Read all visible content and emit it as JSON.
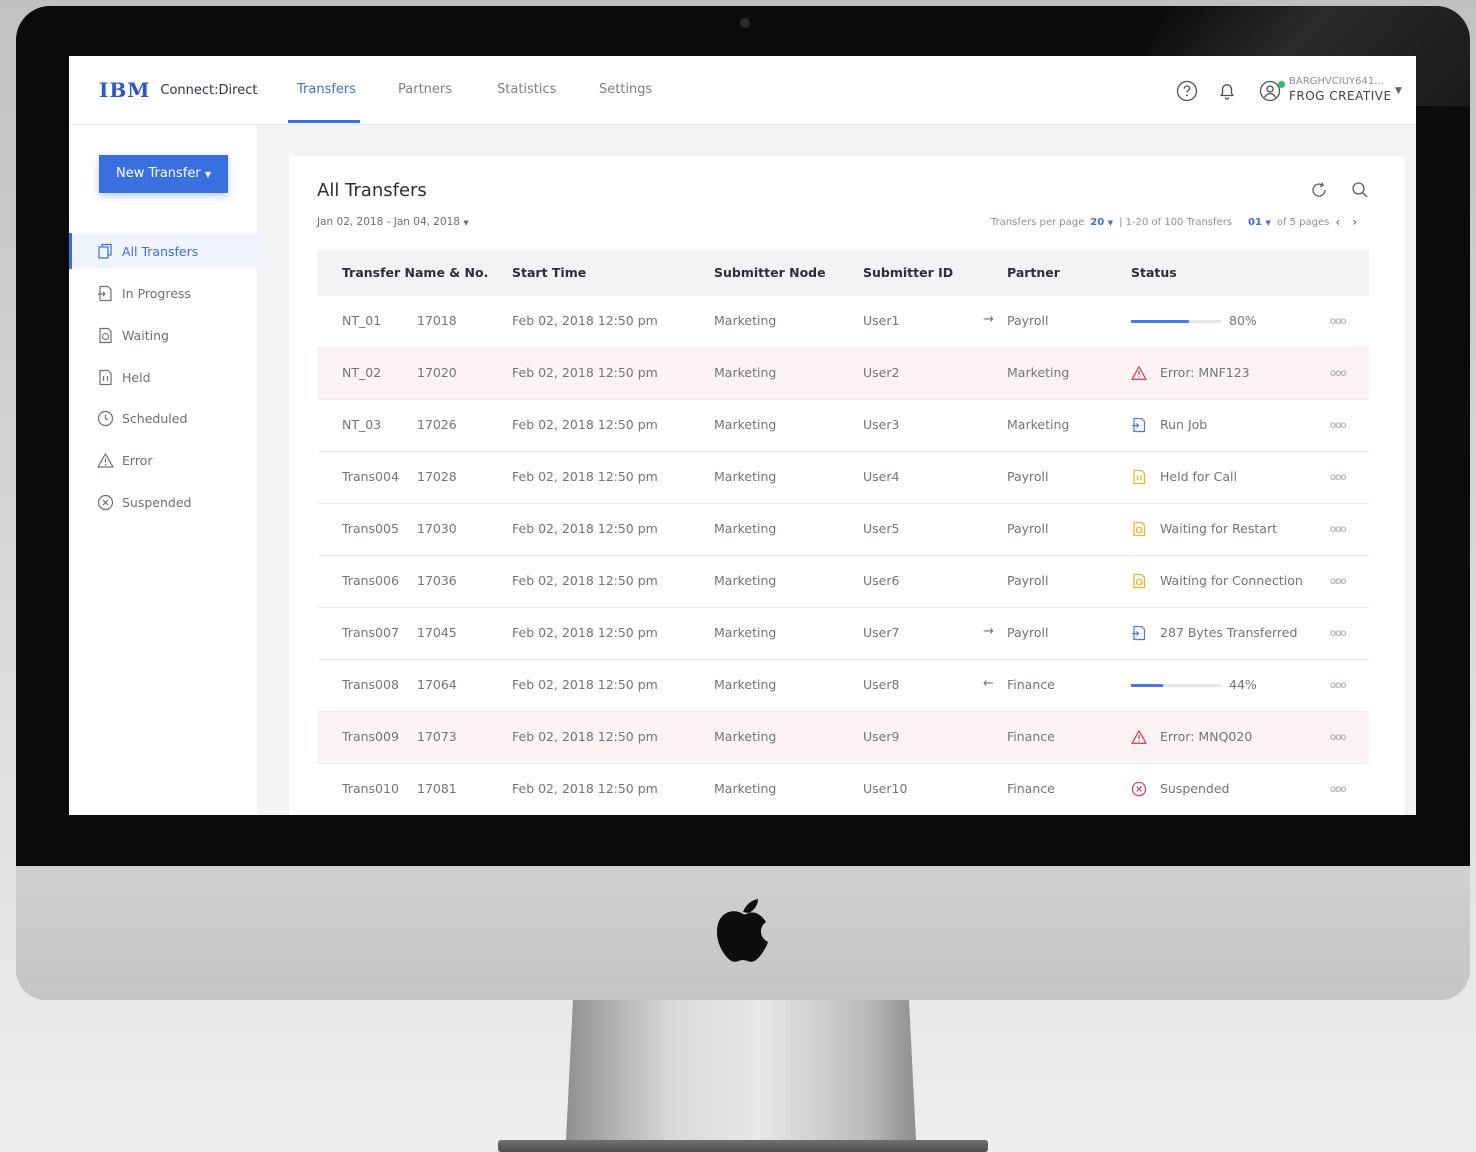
{
  "app": {
    "brand": "IBM",
    "product": "Connect:Direct"
  },
  "nav": {
    "tabs": [
      {
        "label": "Transfers",
        "active": true
      },
      {
        "label": "Partners"
      },
      {
        "label": "Statistics"
      },
      {
        "label": "Settings"
      }
    ],
    "icons": [
      "help-icon",
      "bell-icon",
      "user-icon"
    ],
    "user": {
      "id": "BARGHVCIUY641...",
      "org": "FROG CREATIVE"
    }
  },
  "sidebar": {
    "new_button": "New Transfer",
    "items": [
      {
        "label": "All Transfers",
        "icon": "copy-icon",
        "active": true
      },
      {
        "label": "In Progress",
        "icon": "transfer-doc-icon"
      },
      {
        "label": "Waiting",
        "icon": "waiting-doc-icon"
      },
      {
        "label": "Held",
        "icon": "held-doc-icon"
      },
      {
        "label": "Scheduled",
        "icon": "clock-icon"
      },
      {
        "label": "Error",
        "icon": "warning-icon"
      },
      {
        "label": "Suspended",
        "icon": "cancel-circle-icon"
      }
    ]
  },
  "main": {
    "title": "All Transfers",
    "date_range": "Jan 02, 2018 - Jan 04, 2018",
    "pager": {
      "per_page_label": "Transfers per page",
      "per_page": "20",
      "summary": "| 1-20 of 100 Transfers",
      "page": "01",
      "pages": "of 5 pages"
    },
    "columns": [
      "Transfer Name & No.",
      "Start Time",
      "Submitter Node",
      "Submitter ID",
      "Partner",
      "Status"
    ],
    "rows": [
      {
        "name": "NT_01",
        "no": "17018",
        "start": "Feb 02, 2018  12:50 pm",
        "node": "Marketing",
        "user": "User1",
        "direction": "→",
        "partner": "Payroll",
        "status_type": "progress",
        "progress": 0.8,
        "status": "80%"
      },
      {
        "name": "NT_02",
        "no": "17020",
        "start": "Feb 02, 2018  12:50 pm",
        "node": "Marketing",
        "user": "User2",
        "direction": "",
        "partner": "Marketing",
        "status_type": "error",
        "status": "Error: MNF123"
      },
      {
        "name": "NT_03",
        "no": "17026",
        "start": "Feb 02, 2018  12:50 pm",
        "node": "Marketing",
        "user": "User3",
        "direction": "",
        "partner": "Marketing",
        "status_type": "run",
        "status": "Run Job"
      },
      {
        "name": "Trans004",
        "no": "17028",
        "start": "Feb 02, 2018  12:50 pm",
        "node": "Marketing",
        "user": "User4",
        "direction": "",
        "partner": "Payroll",
        "status_type": "held",
        "status": "Held for Call"
      },
      {
        "name": "Trans005",
        "no": "17030",
        "start": "Feb 02, 2018  12:50 pm",
        "node": "Marketing",
        "user": "User5",
        "direction": "",
        "partner": "Payroll",
        "status_type": "waiting",
        "status": "Waiting for Restart"
      },
      {
        "name": "Trans006",
        "no": "17036",
        "start": "Feb 02, 2018  12:50 pm",
        "node": "Marketing",
        "user": "User6",
        "direction": "",
        "partner": "Payroll",
        "status_type": "waiting",
        "status": "Waiting for Connection"
      },
      {
        "name": "Trans007",
        "no": "17045",
        "start": "Feb 02, 2018  12:50 pm",
        "node": "Marketing",
        "user": "User7",
        "direction": "→",
        "partner": "Payroll",
        "status_type": "run",
        "status": "287 Bytes Transferred"
      },
      {
        "name": "Trans008",
        "no": "17064",
        "start": "Feb 02, 2018  12:50 pm",
        "node": "Marketing",
        "user": "User8",
        "direction": "←",
        "partner": "Finance",
        "status_type": "progress",
        "progress": 0.44,
        "status": "44%"
      },
      {
        "name": "Trans009",
        "no": "17073",
        "start": "Feb 02, 2018  12:50 pm",
        "node": "Marketing",
        "user": "User9",
        "direction": "",
        "partner": "Finance",
        "status_type": "error",
        "status": "Error: MNQ020"
      },
      {
        "name": "Trans010",
        "no": "17081",
        "start": "Feb 02, 2018  12:50 pm",
        "node": "Marketing",
        "user": "User10",
        "direction": "",
        "partner": "Finance",
        "status_type": "suspended",
        "status": "Suspended"
      }
    ]
  },
  "colors": {
    "accent": "#3a6fe0",
    "error": "#d9465b",
    "warning": "#f0b429",
    "bezel": "#0b0b0c"
  }
}
